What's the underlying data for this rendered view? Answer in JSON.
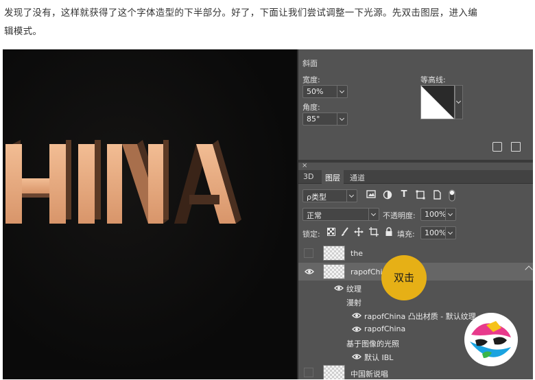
{
  "article": {
    "line1": "发现了没有，这样就获得了这个字体造型的下半部分。好了，下面让我们尝试调整一下光源。先双击图层，进入编",
    "line2": "辑模式。"
  },
  "canvas": {
    "artwork_text": "HINA"
  },
  "properties": {
    "section_title": "斜面",
    "width_label": "宽度:",
    "width_value": "50%",
    "angle_label": "角度:",
    "angle_value": "85°",
    "contour_label": "等高线:"
  },
  "layers_panel": {
    "close_glyph": "×",
    "tabs": [
      "3D",
      "图层",
      "通道"
    ],
    "filter_label": "ρ类型",
    "blend_mode": "正常",
    "opacity_label": "不透明度:",
    "opacity_value": "100%",
    "lock_label": "锁定:",
    "fill_label": "填充:",
    "fill_value": "100%",
    "layers": [
      {
        "name": "the"
      },
      {
        "name": "rapofChina"
      },
      {
        "name": "纹理"
      },
      {
        "name": "漫射"
      },
      {
        "name": "rapofChina 凸出材质 - 默认纹理"
      },
      {
        "name": "rapofChina"
      },
      {
        "name": "基于图像的光照"
      },
      {
        "name": "默认 IBL"
      },
      {
        "name": "中国新说唱"
      }
    ]
  },
  "callout": {
    "label": "双击"
  },
  "colors": {
    "accent_badge": "#e6b016",
    "panel_bg": "#535353",
    "letter_face": "#e4a77d"
  },
  "icons": [
    "eye-icon",
    "trash-icon",
    "lock-icon",
    "brush-icon",
    "move-icon",
    "image-filter-icon",
    "adjust-filter-icon",
    "type-filter-icon"
  ]
}
